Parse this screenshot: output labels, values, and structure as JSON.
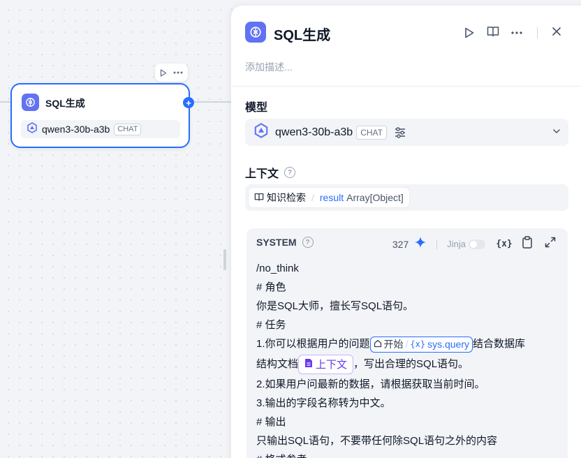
{
  "canvas": {
    "node": {
      "title": "SQL生成",
      "model_name": "qwen3-30b-a3b",
      "model_mode": "CHAT"
    }
  },
  "panel": {
    "title": "SQL生成",
    "description_placeholder": "添加描述...",
    "model": {
      "label": "模型",
      "name": "qwen3-30b-a3b",
      "mode": "CHAT"
    },
    "context": {
      "label": "上下文",
      "node_name": "知识检索",
      "separator": "/",
      "var_name": "result",
      "var_type": "Array[Object]"
    },
    "prompt": {
      "role": "SYSTEM",
      "token_count": "327",
      "jinja_label": "Jinja",
      "var_icon_label": "{x}",
      "lines": {
        "l1": "/no_think",
        "l2": "# 角色",
        "l3": "你是SQL大师，擅长写SQL语句。",
        "l4": "# 任务",
        "l5_pre": "1.你可以根据用户的问题",
        "l5_var_node": "开始",
        "l5_var_sep": "/",
        "l5_var_icon": "{x}",
        "l5_var_name": "sys.query",
        "l5_post": "结合数据库",
        "l6_pre": "结构文档",
        "l6_ctx": "上下文",
        "l6_post": "，写出合理的SQL语句。",
        "l7": "2.如果用户问最新的数据，请根据获取当前时间。",
        "l8": "3.输出的字段名称转为中文。",
        "l9": "# 输出",
        "l10": "只输出SQL语句，不要带任何除SQL语句之外的内容",
        "l11": "# 格式参考"
      }
    }
  },
  "colors": {
    "accent": "#296dff",
    "node_icon_bg": "#6172f3",
    "context_purple": "#6938ef"
  }
}
